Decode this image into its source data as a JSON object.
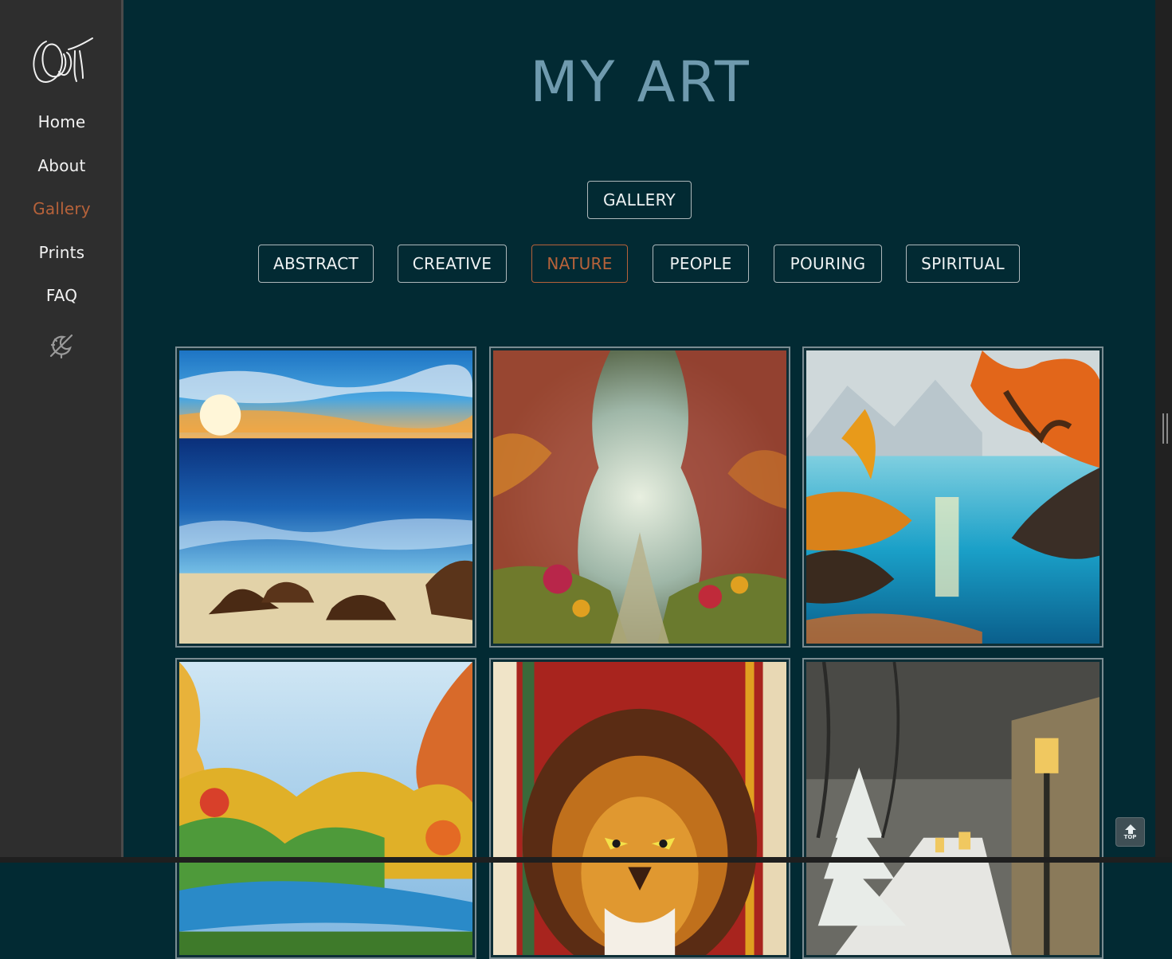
{
  "nav": {
    "items": [
      {
        "label": "Home"
      },
      {
        "label": "About"
      },
      {
        "label": "Gallery",
        "active": true
      },
      {
        "label": "Prints"
      },
      {
        "label": "FAQ"
      }
    ]
  },
  "main": {
    "title": "MY ART",
    "gallery_button": "GALLERY",
    "categories": [
      "ABSTRACT",
      "CREATIVE",
      "NATURE",
      "PEOPLE",
      "POURING",
      "SPIRITUAL"
    ],
    "active_category": "NATURE"
  },
  "paintings": [
    {
      "subject": "sunset over the sea with rocks on the beach"
    },
    {
      "subject": "misty forest path with autumn trees"
    },
    {
      "subject": "autumn trees by a turquoise lake with mountains"
    },
    {
      "subject": "autumn landscape with a river"
    },
    {
      "subject": "lion portrait"
    },
    {
      "subject": "snowy street with lanterns at night"
    }
  ],
  "back_to_top": {
    "label": "TOP"
  },
  "colors": {
    "background": "#022a33",
    "sidebar": "#2e2e2e",
    "accent": "#b6623a",
    "title": "#6f9aae"
  },
  "icons": {
    "logo": "signature-logo",
    "theme_toggle": "theme-toggle-icon",
    "back_to_top": "arrow-up-icon"
  }
}
